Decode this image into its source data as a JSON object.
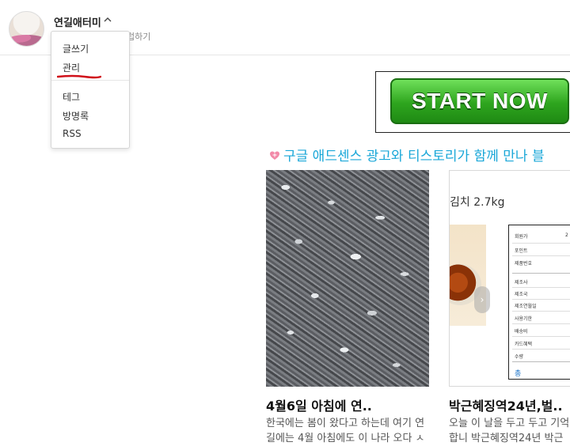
{
  "header": {
    "username": "연길애터미",
    "partial_text": "럽하기"
  },
  "dropdown": {
    "items": [
      "글쓰기",
      "관리",
      "테그",
      "방명록",
      "RSS"
    ]
  },
  "banner": {
    "label": "START NOW",
    "color": "#2ea51e"
  },
  "promo": {
    "text": "구글 애드센스 광고와 티스토리가 함께 만나 블",
    "heart_icon": "heart-icon",
    "color": "#1aa7d8"
  },
  "cards": [
    {
      "title": "4월6일 아침에 연..",
      "excerpt_line1": "한국에는 봄이 왔다고 하는데 여기 연",
      "excerpt_line2": "길에는 4월 아침에도 이 나라 오다 ㅅ"
    },
    {
      "title": "박근혜징역24년,벌..",
      "excerpt_line1": "오늘 이 날을 두고 두고 기억",
      "excerpt_line2": "합니 박근혜징역24년 박근"
    }
  ],
  "product_image": {
    "label": "김치 2.7kg",
    "spec_rows": [
      "회원가",
      "포인트",
      "제품번호",
      "제조사",
      "제조국",
      "제조연월일",
      "사용기한",
      "배송비",
      "카드혜택",
      "수량"
    ],
    "spec_values": [
      "2",
      "",
      "",
      "",
      "",
      "",
      "",
      "",
      "",
      ""
    ],
    "total_label": "총"
  }
}
